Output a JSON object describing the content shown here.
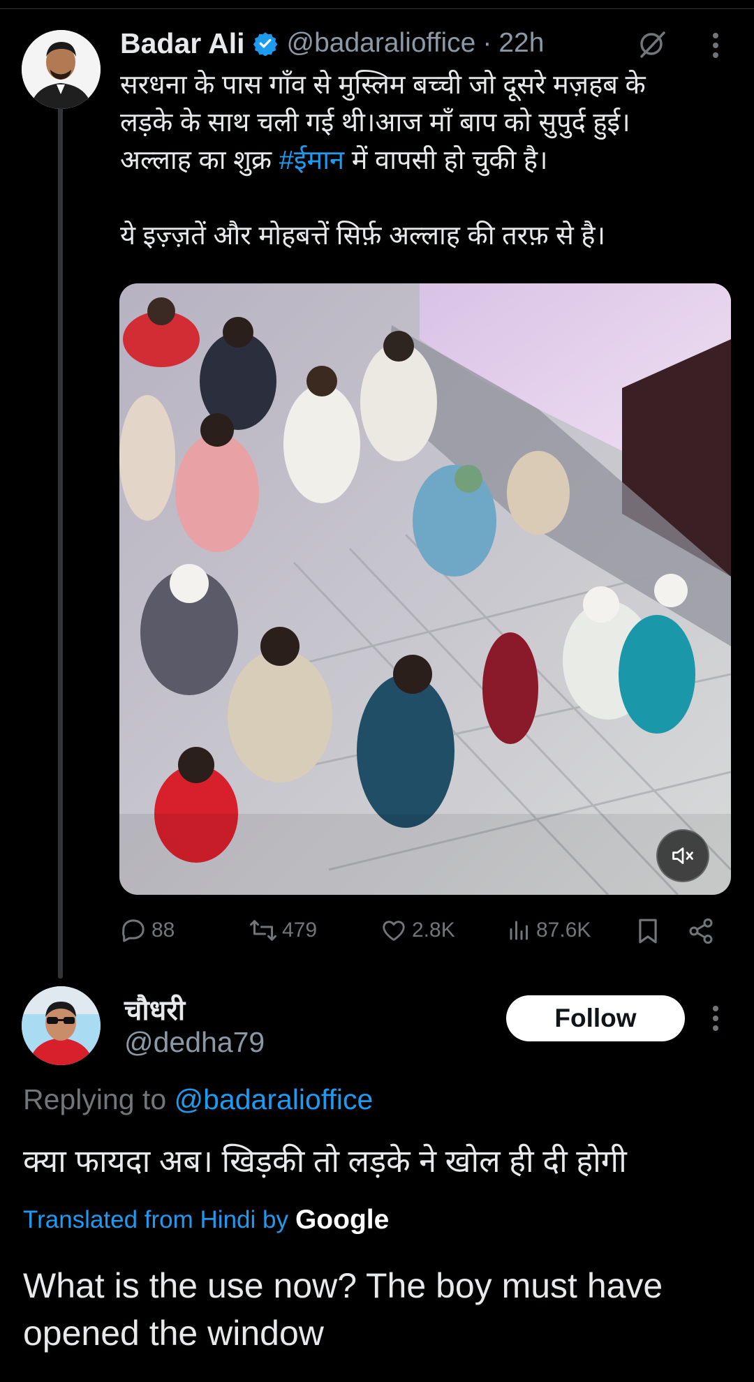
{
  "tweet": {
    "author_name": "Badar Ali",
    "handle": "@badaralioffice",
    "separator": "·",
    "time": "22h",
    "text_lines": [
      "सरधना के पास गाँव से मुस्लिम बच्ची जो दूसरे मज़हब के",
      "लड़के के साथ चली गई थी।आज माँ बाप को सुपुर्द हुई।"
    ],
    "line3_prefix": "अल्लाह का शुक्र ",
    "hashtag": "#ईमान",
    "line3_suffix": " में वापसी हो चुकी है।",
    "line4": "ये इज़्ज़तें और मोहबत्तें सिर्फ़ अल्लाह की तरफ़ से है।",
    "stats": {
      "replies": "88",
      "reposts": "479",
      "likes": "2.8K",
      "views": "87.6K"
    }
  },
  "reply": {
    "author_name": "चौधरी",
    "handle": "@dedha79",
    "follow_label": "Follow",
    "replying_prefix": "Replying to ",
    "replying_mention": "@badaralioffice",
    "text": "क्या फायदा अब। खिड़की तो लड़के ने खोल ही दी होगी",
    "translated_label": "Translated from Hindi by",
    "translator": "Google",
    "translation": "What is the use now? The boy must have opened the window"
  },
  "colors": {
    "background": "#000000",
    "text": "#e7e9ea",
    "muted": "#71767b",
    "accent": "#1d9bf0"
  },
  "icons": [
    "verified-badge-icon",
    "grok-icon",
    "more-icon",
    "reply-icon",
    "repost-icon",
    "like-icon",
    "views-icon",
    "bookmark-icon",
    "share-icon",
    "mute-icon"
  ]
}
